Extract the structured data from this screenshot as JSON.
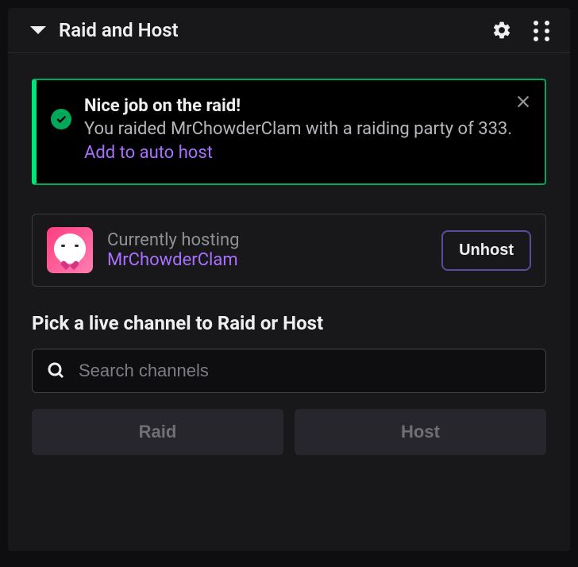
{
  "header": {
    "title": "Raid and Host"
  },
  "alert": {
    "title": "Nice job on the raid!",
    "text_prefix": "You raided ",
    "raided_name": "MrChowderClam",
    "text_middle": " with a raiding party of ",
    "party_count": "333",
    "text_suffix": ". ",
    "link_text": "Add to auto host"
  },
  "hosting": {
    "label": "Currently hosting",
    "name": "MrChowderClam",
    "unhost_label": "Unhost"
  },
  "section": {
    "title": "Pick a live channel to Raid or Host",
    "search_placeholder": "Search channels"
  },
  "buttons": {
    "raid": "Raid",
    "host": "Host"
  },
  "colors": {
    "accent_purple": "#a970ff",
    "success_green": "#00a859",
    "background": "#18181b"
  }
}
